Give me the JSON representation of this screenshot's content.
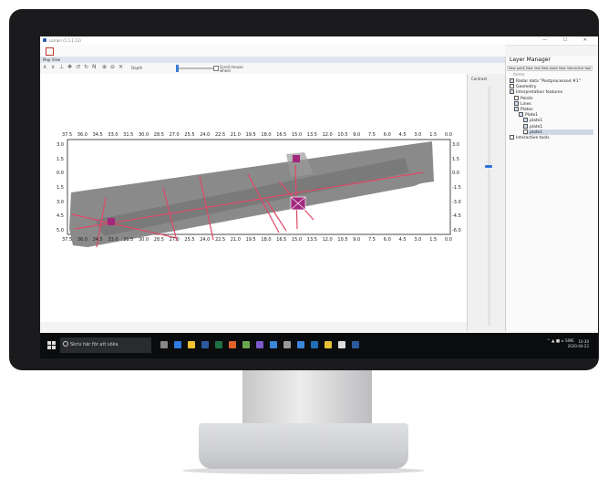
{
  "window": {
    "title": "Lorrain (1.1.1.13)",
    "controls": "— ☐ ✕"
  },
  "view": {
    "tab": "Map View",
    "close_glyph": "✕"
  },
  "toolbar": {
    "depth_label": "Depth",
    "scroll_label": "Scroll mouse wheel"
  },
  "plot": {
    "x_ticks": [
      "37.5",
      "36.0",
      "34.5",
      "33.0",
      "31.5",
      "30.0",
      "28.5",
      "27.0",
      "25.5",
      "24.0",
      "22.5",
      "21.0",
      "19.5",
      "18.0",
      "16.5",
      "15.0",
      "13.5",
      "12.0",
      "10.5",
      "9.0",
      "7.5",
      "6.0",
      "4.5",
      "3.0",
      "1.5",
      "0.0"
    ],
    "y_ticks_left": [
      "3.0",
      "1.5",
      "0.0",
      "-1.5",
      "-3.0",
      "-4.5",
      "-6.0"
    ],
    "y_ticks_left_display": [
      "3.0",
      "1.5",
      "0.0",
      "1.5",
      "3.0",
      "4.5",
      "5.0"
    ],
    "y_ticks_right": [
      "3.0",
      "1.5",
      "0.0",
      "-1.5",
      "-3.0",
      "-4.5",
      "-6.0"
    ],
    "marker_labels": [
      "0",
      "0",
      "0"
    ],
    "compass": "N"
  },
  "contrast": {
    "label": "Contrast"
  },
  "layer_manager": {
    "title": "Layer Manager",
    "buttons": [
      "New point",
      "New line",
      "New plate",
      "New interactive tool"
    ],
    "section_label": "Items",
    "items": [
      {
        "label": "Radar data \"Postprocessed #1\"",
        "checked": true,
        "indent": 0
      },
      {
        "label": "Geometry",
        "checked": false,
        "indent": 0
      },
      {
        "label": "Interpretation features",
        "checked": true,
        "indent": 0
      },
      {
        "label": "Points",
        "checked": false,
        "indent": 1
      },
      {
        "label": "Lines",
        "checked": true,
        "indent": 1
      },
      {
        "label": "Plates",
        "checked": true,
        "indent": 1
      },
      {
        "label": "Plate1",
        "checked": true,
        "indent": 2
      },
      {
        "label": "plate1",
        "checked": true,
        "indent": 3
      },
      {
        "label": "plate1",
        "checked": true,
        "indent": 3
      },
      {
        "label": "plate1",
        "checked": false,
        "indent": 3,
        "selected": true
      },
      {
        "label": "Interactive tools",
        "checked": false,
        "indent": 0
      }
    ]
  },
  "taskbar": {
    "search_placeholder": "Skriv här för att söka",
    "tray": "^ ▲ ■ ⌂ SWE",
    "time": "10:30",
    "date": "2020-04-22"
  },
  "colors": {
    "accent": "#2d74d8",
    "marker": "#a2277d",
    "line": "#e04868",
    "taskbar": "#0b0c0e"
  }
}
